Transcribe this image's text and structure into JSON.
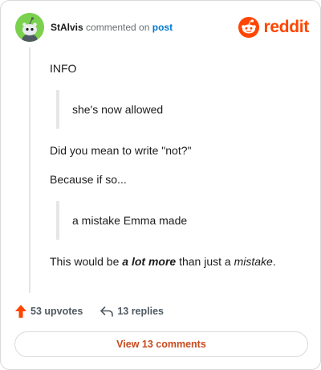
{
  "header": {
    "username": "StAlvis",
    "action_text": "commented on",
    "post_link": "post",
    "brand_wordmark": "reddit",
    "avatar_icon": "snoo-avatar-icon",
    "brand_icon": "reddit-alien-icon"
  },
  "comment": {
    "p1": "INFO",
    "quote1": "she's now allowed",
    "p2": "Did you mean to write \"not?\"",
    "p3": "Because if so...",
    "quote2": "a mistake Emma made",
    "p4_a": "This would be ",
    "p4_b": "a lot more",
    "p4_c": " than just a ",
    "p4_d": "mistake",
    "p4_e": "."
  },
  "actions": {
    "upvotes": "53 upvotes",
    "replies": "13 replies",
    "upvote_icon": "upvote-arrow-icon",
    "reply_icon": "reply-arrow-icon"
  },
  "footer": {
    "view_comments": "View 13 comments"
  },
  "colors": {
    "brand": "#ff4500",
    "avatar": "#7bd14f",
    "link": "#0079d3",
    "button_text": "#c94a1d",
    "meta_gray": "#6a6f72"
  }
}
